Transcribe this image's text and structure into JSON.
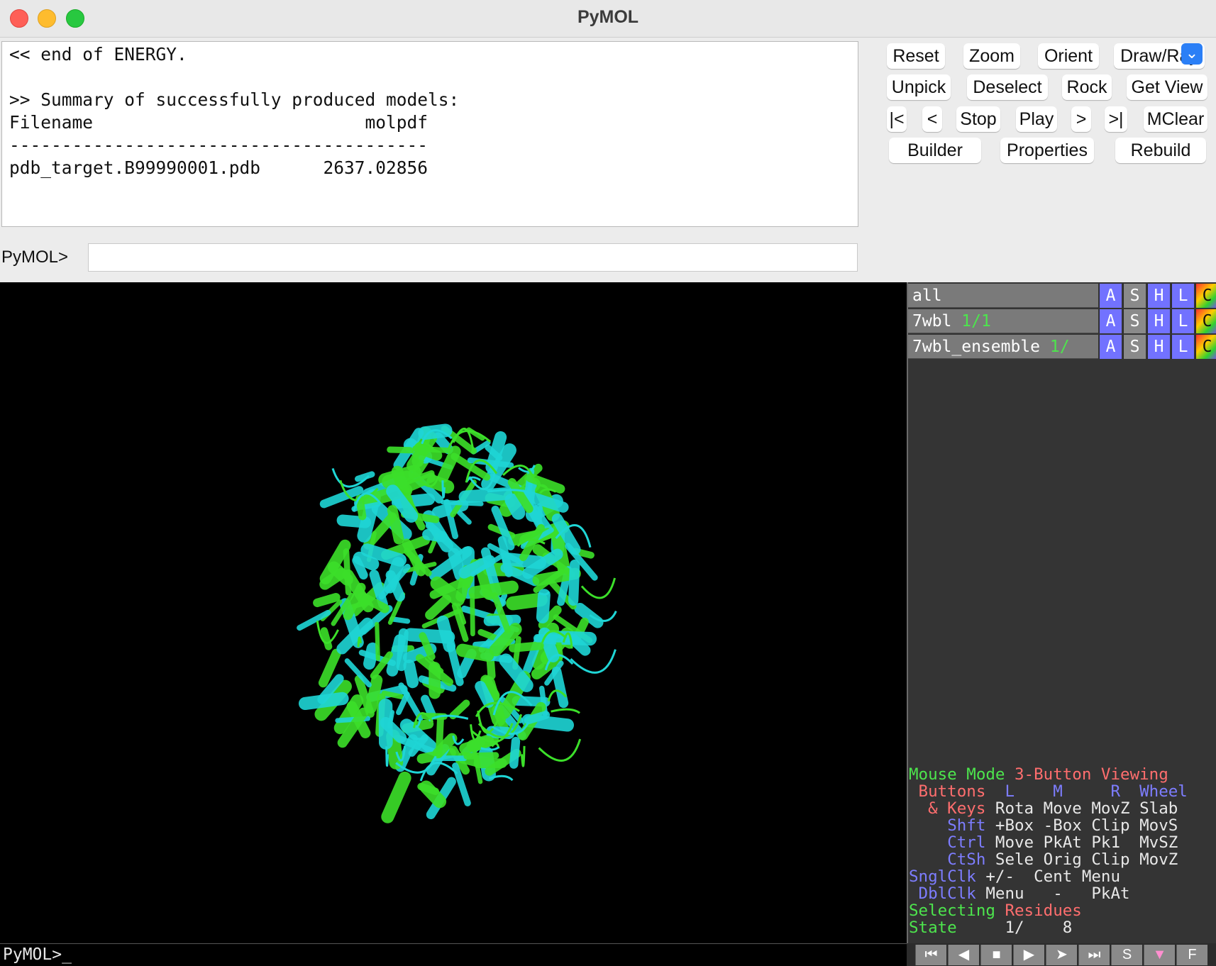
{
  "window": {
    "title": "PyMOL"
  },
  "console": {
    "lines": [
      "<< end of ENERGY.",
      "",
      ">> Summary of successfully produced models:",
      "Filename                          molpdf",
      "----------------------------------------",
      "pdb_target.B99990001.pdb      2637.02856"
    ]
  },
  "command": {
    "prompt": "PyMOL>",
    "value": ""
  },
  "buttons": {
    "row1": [
      "Reset",
      "Zoom",
      "Orient",
      "Draw/Ray"
    ],
    "row2": [
      "Unpick",
      "Deselect",
      "Rock",
      "Get View"
    ],
    "row3": [
      "|<",
      "<",
      "Stop",
      "Play",
      ">",
      ">|",
      "MClear"
    ],
    "row4": [
      "Builder",
      "Properties",
      "Rebuild"
    ]
  },
  "objects": [
    {
      "name": "all",
      "state": ""
    },
    {
      "name": "7wbl",
      "state": "1/1"
    },
    {
      "name": "7wbl_ensemble",
      "state": "1/"
    }
  ],
  "object_buttons": [
    "A",
    "S",
    "H",
    "L",
    "C"
  ],
  "mouse_mode": {
    "title_a": "Mouse Mode",
    "title_b": "3-Button Viewing",
    "buttons_label": "Buttons",
    "cols": [
      "L",
      "M",
      "R",
      "Wheel"
    ],
    "keys_label": "& Keys",
    "keys_row": [
      "Rota",
      "Move",
      "MovZ",
      "Slab"
    ],
    "shft_label": "Shft",
    "shft_row": [
      "+Box",
      "-Box",
      "Clip",
      "MovS"
    ],
    "ctrl_label": "Ctrl",
    "ctrl_row": [
      "Move",
      "PkAt",
      "Pk1",
      "MvSZ"
    ],
    "ctsh_label": "CtSh",
    "ctsh_row": [
      "Sele",
      "Orig",
      "Clip",
      "MovZ"
    ],
    "sngl_label": "SnglClk",
    "sngl_row": [
      "+/-",
      "Cent",
      "Menu"
    ],
    "dbl_label": "DblClk",
    "dbl_row": [
      "Menu",
      "-",
      "PkAt"
    ],
    "selecting_a": "Selecting",
    "selecting_b": "Residues",
    "state_label": "State",
    "state_value": "1/",
    "state_total": "8"
  },
  "bottom_prompt": "PyMOL>_",
  "player_buttons": [
    "skip-start",
    "back",
    "stop",
    "play",
    "forward",
    "skip-end",
    "S",
    "menu",
    "F"
  ],
  "colors": {
    "green": "#3ce02a",
    "cyan": "#1fd6d6",
    "background": "#000000"
  }
}
